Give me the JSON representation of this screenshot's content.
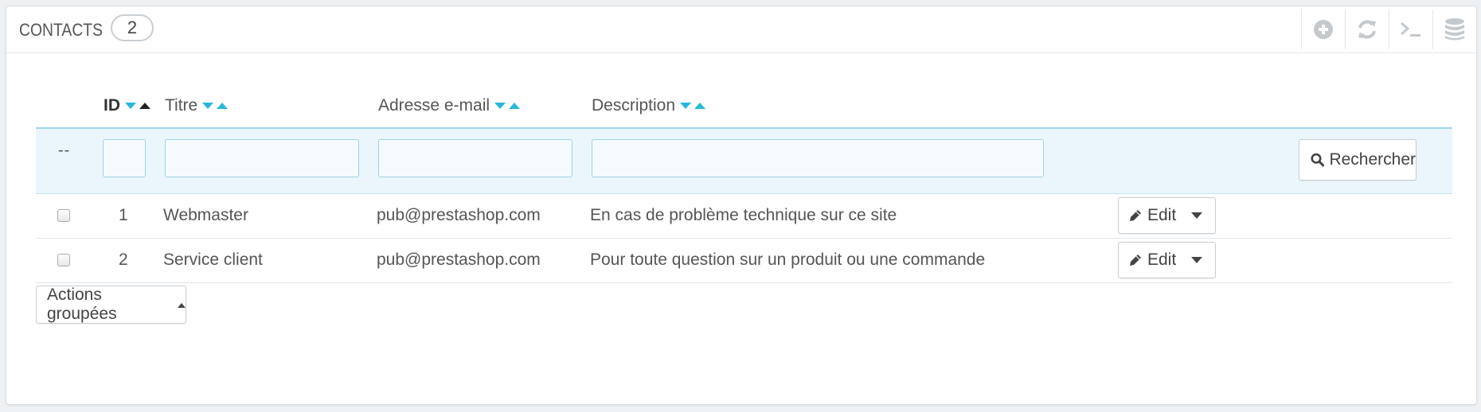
{
  "panel": {
    "title": "CONTACTS",
    "count": "2"
  },
  "toolbar": {
    "icons": [
      "add-icon",
      "refresh-icon",
      "sql-query-icon",
      "database-export-icon"
    ]
  },
  "table": {
    "columns": [
      {
        "key": "id",
        "label": "ID"
      },
      {
        "key": "title",
        "label": "Titre"
      },
      {
        "key": "email",
        "label": "Adresse e-mail"
      },
      {
        "key": "description",
        "label": "Description"
      }
    ],
    "filter": {
      "placeholder_dash": "--",
      "search_label": "Rechercher"
    },
    "rows": [
      {
        "id": "1",
        "title": "Webmaster",
        "email": "pub@prestashop.com",
        "description": "En cas de problème technique sur ce site",
        "action": "Edit"
      },
      {
        "id": "2",
        "title": "Service client",
        "email": "pub@prestashop.com",
        "description": "Pour toute question sur un produit ou une commande",
        "action": "Edit"
      }
    ]
  },
  "bulk_actions": {
    "label": "Actions groupées"
  },
  "colors": {
    "accent": "#25b9d7",
    "filter_bg": "#eaf6fc",
    "text": "#555555"
  }
}
